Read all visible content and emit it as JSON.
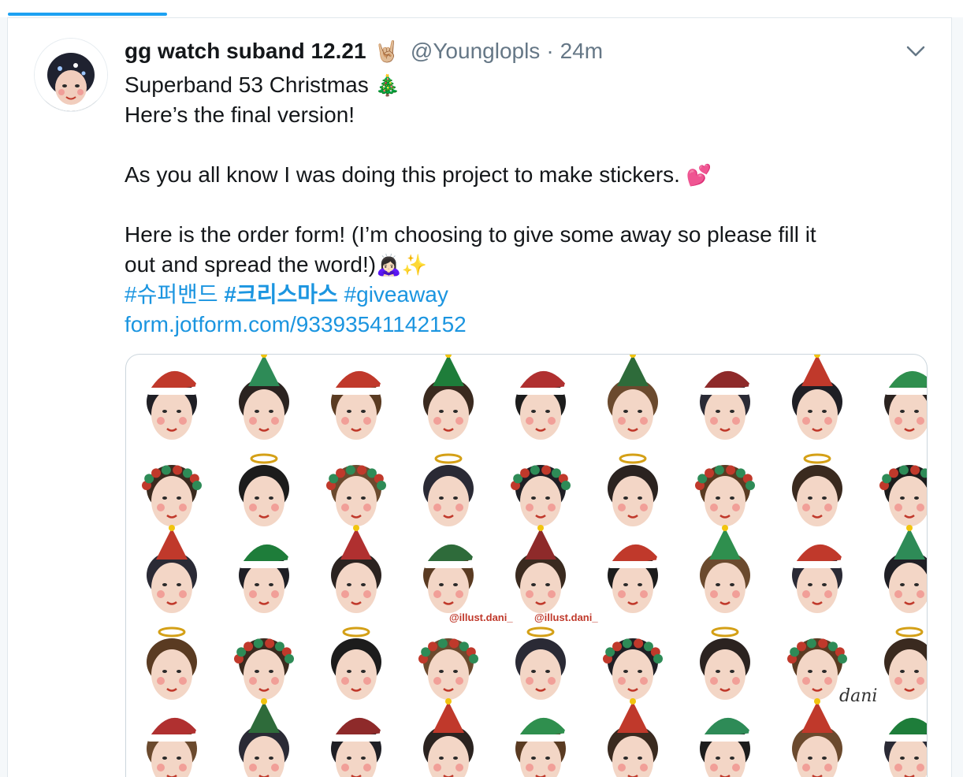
{
  "tweet": {
    "display_name": "gg watch suband 12.21",
    "name_emoji": "🤘🏼",
    "handle": "@Younglopls",
    "separator": "·",
    "time": "24m",
    "lines": {
      "l1_text": "Superband 53 Christmas ",
      "l1_emoji": "🎄",
      "l2_text": "Here’s the final version!",
      "l3_text": "As you all know I was doing this project to make stickers. ",
      "l3_emoji": "💕",
      "l4_text": "Here is the order form! (I’m choosing to give some away so please fill it",
      "l5_text": "out and spread the word!)",
      "l5_emoji": "🙇🏻‍♀️✨"
    },
    "hashtags": [
      "#슈퍼밴드",
      "#크리스마스",
      "#giveaway"
    ],
    "link": "form.jotform.com/93393541142152"
  },
  "media": {
    "watermark_1": "@illust.dani_",
    "watermark_2": "@illust.dani_",
    "signature": "dani"
  },
  "colors": {
    "accent": "#1da1f2",
    "link": "#1b95e0",
    "text": "#14171a",
    "secondary": "#657786"
  }
}
